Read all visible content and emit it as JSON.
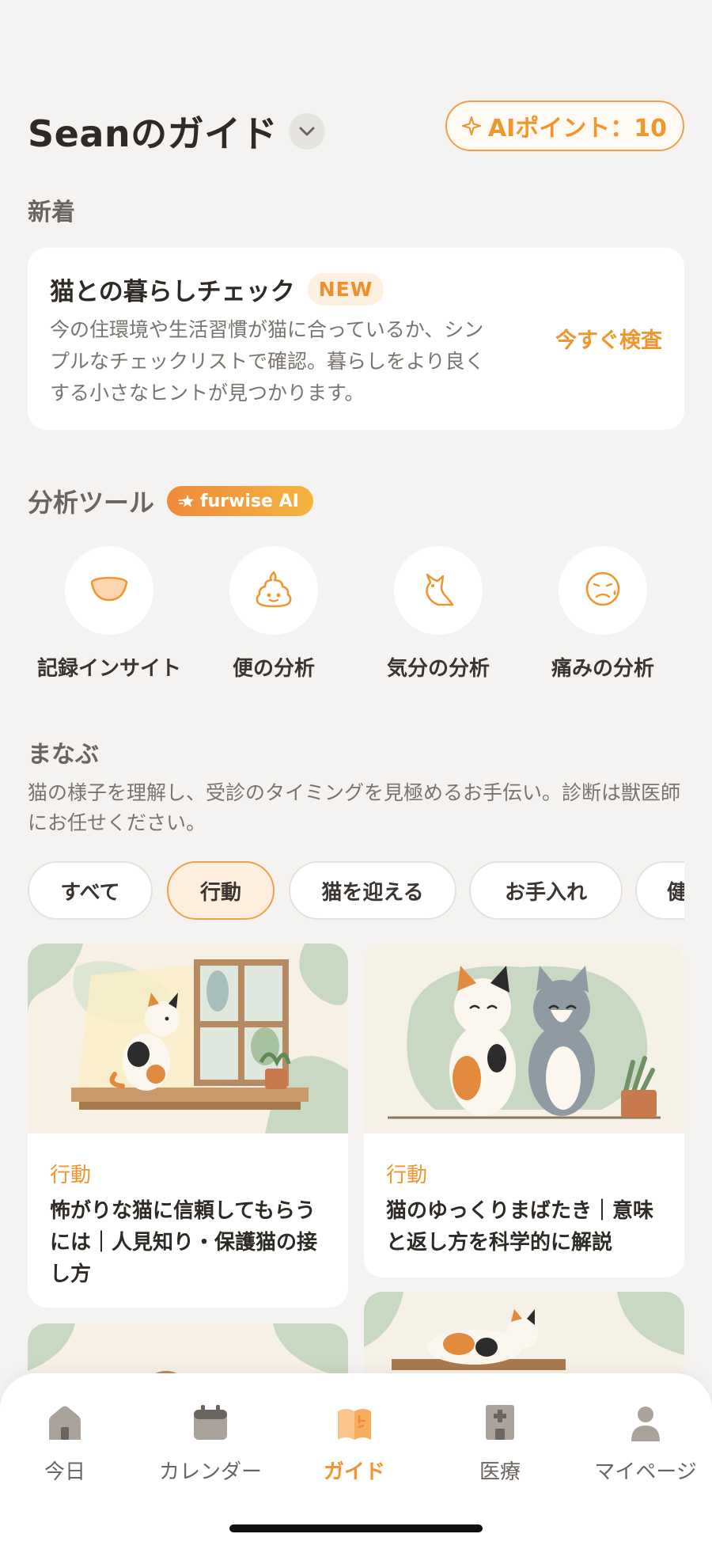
{
  "header": {
    "title": "Seanのガイド",
    "ai_points": "AIポイント：10"
  },
  "new_section": {
    "label": "新着",
    "card": {
      "title": "猫との暮らしチェック",
      "badge": "NEW",
      "description": "今の住環境や生活習慣が猫に合っているか、シンプルなチェックリストで確認。暮らしをより良くする小さなヒントが見つかります。",
      "action": "今すぐ検査"
    }
  },
  "tools": {
    "label": "分析ツール",
    "ai_badge": "furwise AI",
    "items": [
      {
        "label": "記録インサイト",
        "icon": "bowl-icon"
      },
      {
        "label": "便の分析",
        "icon": "poop-icon"
      },
      {
        "label": "気分の分析",
        "icon": "cat-mood-icon"
      },
      {
        "label": "痛みの分析",
        "icon": "pain-face-icon"
      }
    ]
  },
  "learn": {
    "label": "まなぶ",
    "description": "猫の様子を理解し、受診のタイミングを見極めるお手伝い。診断は獣医師にお任せください。",
    "chips": [
      "すべて",
      "行動",
      "猫を迎える",
      "お手入れ",
      "健"
    ],
    "active_chip": "行動",
    "articles": [
      {
        "category": "行動",
        "title": "怖がりな猫に信頼してもらうには｜人見知り・保護猫の接し方"
      },
      {
        "category": "行動",
        "title": "猫のゆっくりまばたき｜意味と返し方を科学的に解説"
      }
    ]
  },
  "nav": {
    "items": [
      {
        "label": "今日",
        "icon": "house-icon"
      },
      {
        "label": "カレンダー",
        "icon": "calendar-icon"
      },
      {
        "label": "ガイド",
        "icon": "book-icon"
      },
      {
        "label": "医療",
        "icon": "hospital-icon"
      },
      {
        "label": "マイページ",
        "icon": "person-icon"
      }
    ],
    "active": "ガイド"
  },
  "colors": {
    "accent": "#f0962e",
    "background": "#f4f3f1",
    "card": "#ffffff",
    "muted_text": "#7a746e"
  }
}
